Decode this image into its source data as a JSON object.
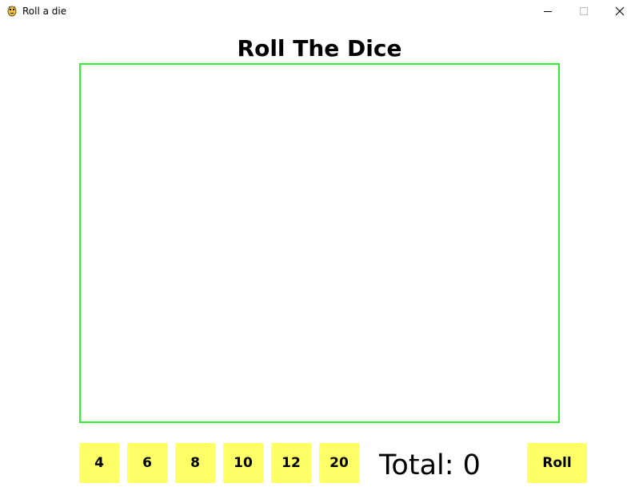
{
  "window": {
    "title": "Roll a die",
    "icon": "python-snake-icon"
  },
  "header": {
    "title": "Roll The Dice"
  },
  "dice_buttons": [
    {
      "label": "4"
    },
    {
      "label": "6"
    },
    {
      "label": "8"
    },
    {
      "label": "10"
    },
    {
      "label": "12"
    },
    {
      "label": "20"
    }
  ],
  "total": {
    "text": "Total: 0"
  },
  "roll": {
    "label": "Roll"
  },
  "colors": {
    "button_bg": "#ffff66",
    "dice_area_border": "#33ee33"
  }
}
